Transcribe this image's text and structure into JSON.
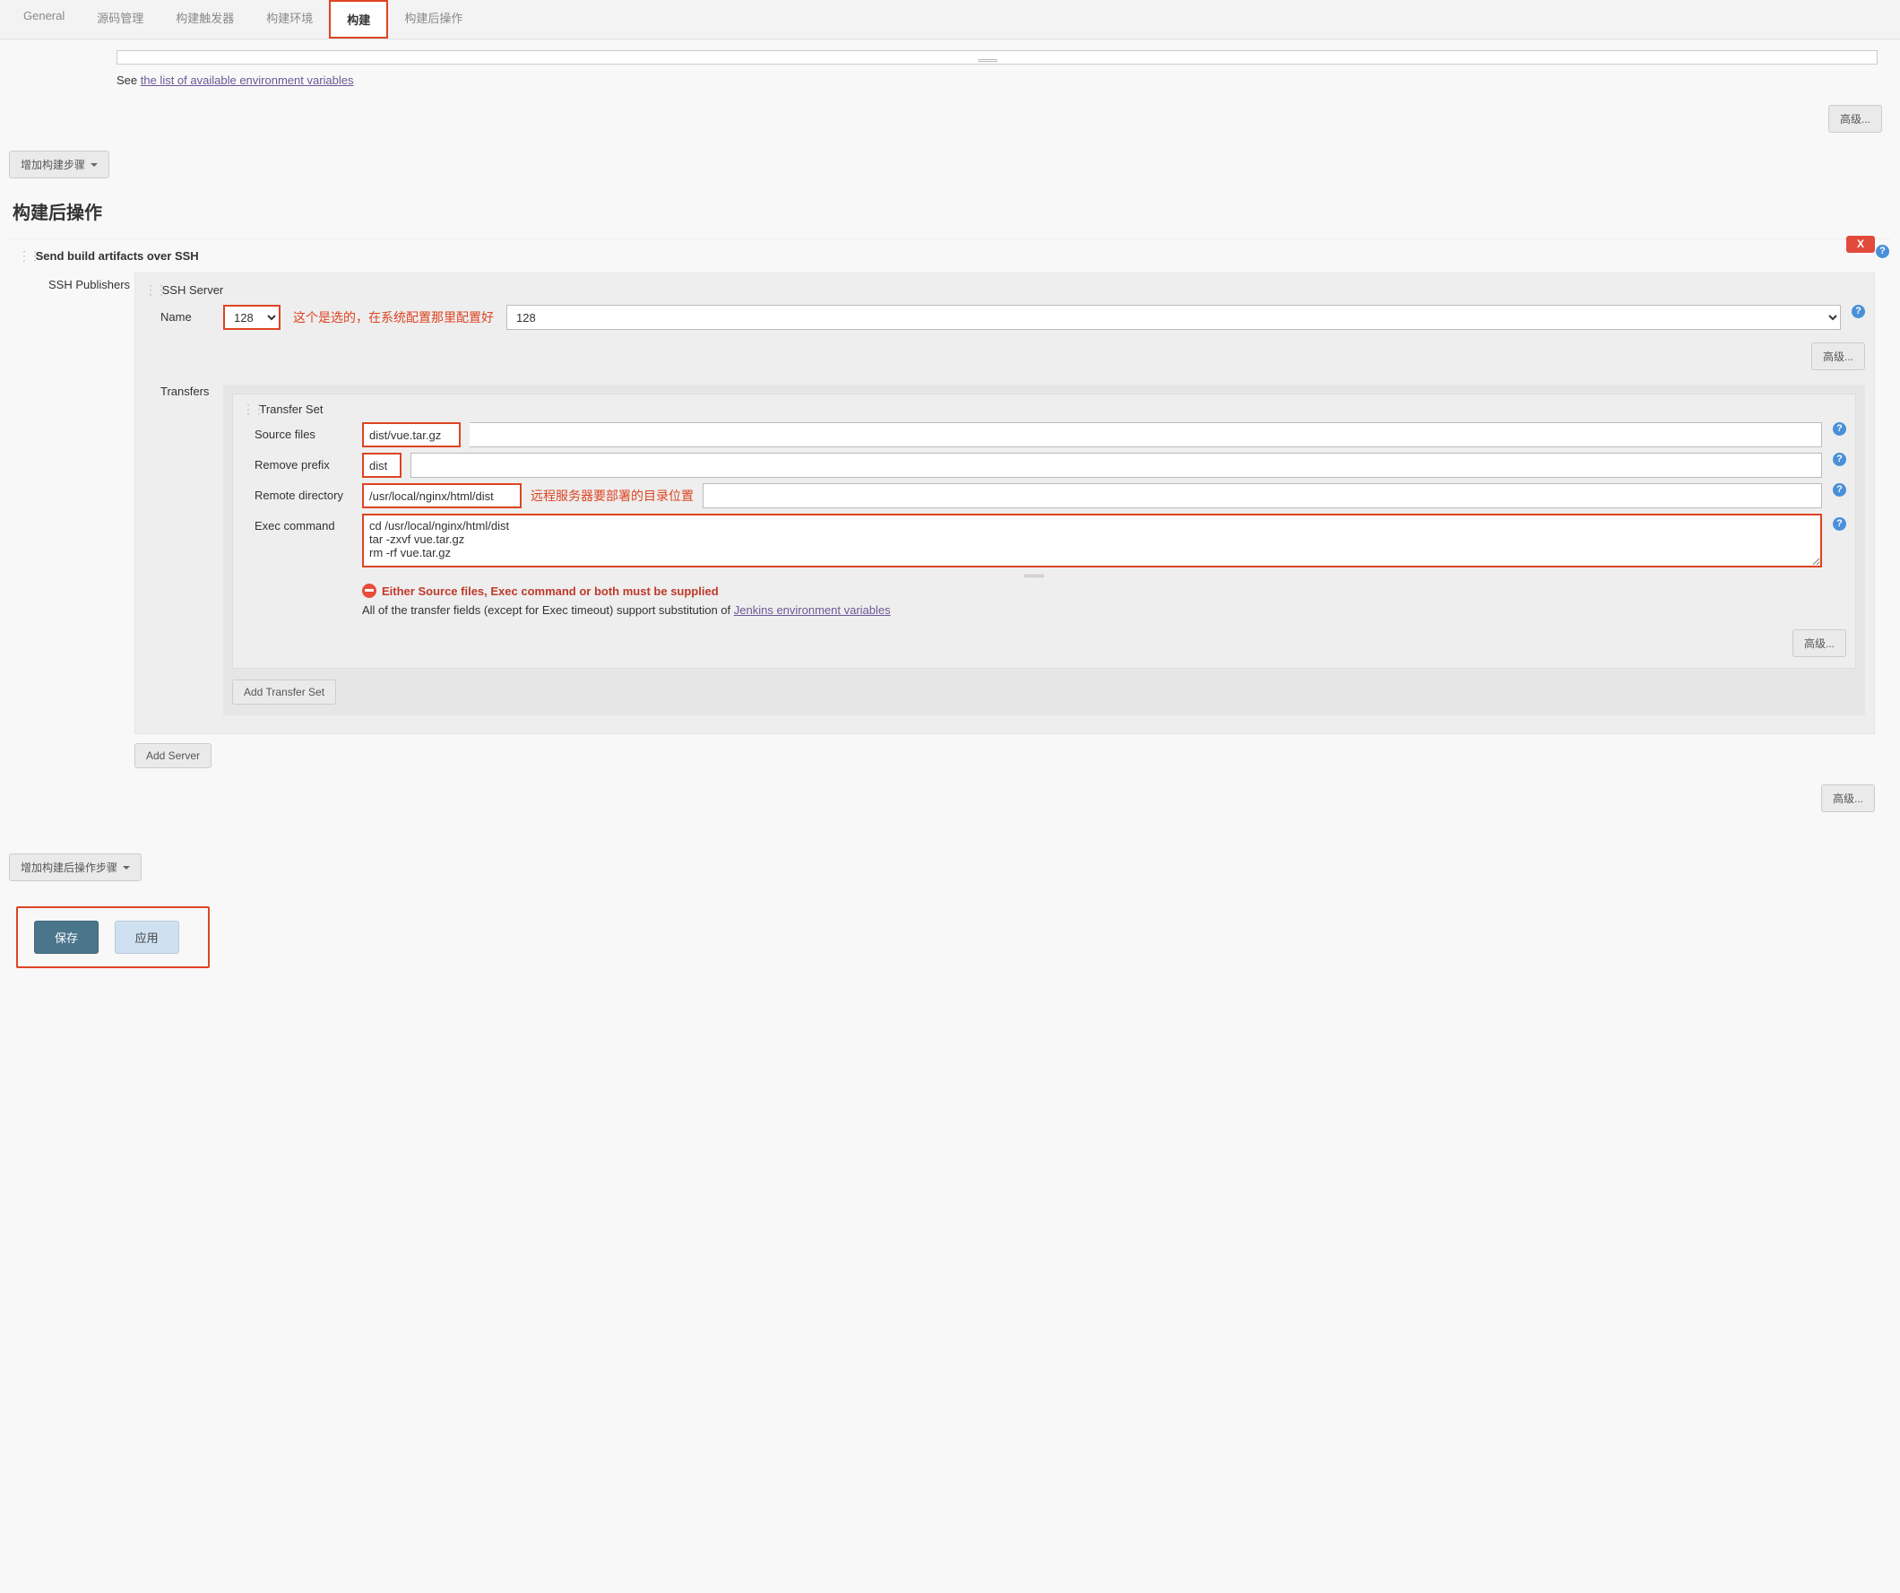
{
  "tabs": {
    "general": "General",
    "scm": "源码管理",
    "triggers": "构建触发器",
    "env": "构建环境",
    "build": "构建",
    "post": "构建后操作"
  },
  "upper": {
    "see": "See ",
    "env_link": "the list of available environment variables",
    "advanced": "高级...",
    "add_step": "增加构建步骤"
  },
  "post_title": "构建后操作",
  "block": {
    "title": "Send build artifacts over SSH",
    "close": "X",
    "ssh_publishers_label": "SSH Publishers",
    "ssh_server_label": "SSH Server",
    "name_label": "Name",
    "name_value": "128",
    "name_annot": "这个是选的，在系统配置那里配置好",
    "advanced": "高级...",
    "transfers_label": "Transfers",
    "transfer_set_label": "Transfer Set",
    "source_label": "Source files",
    "source_value": "dist/vue.tar.gz",
    "prefix_label": "Remove prefix",
    "prefix_value": "dist",
    "remote_label": "Remote directory",
    "remote_value": "/usr/local/nginx/html/dist",
    "remote_annot": "远程服务器要部署的目录位置",
    "exec_label": "Exec command",
    "exec_value": "cd /usr/local/nginx/html/dist\ntar -zxvf vue.tar.gz\nrm -rf vue.tar.gz",
    "error": "Either Source files, Exec command or both must be supplied",
    "note_pre": "All of the transfer fields (except for Exec timeout) support substitution of ",
    "note_link": "Jenkins environment variables",
    "add_transfer_set": "Add Transfer Set",
    "add_server": "Add Server"
  },
  "bottom": {
    "advanced": "高级...",
    "add_post_step": "增加构建后操作步骤",
    "save": "保存",
    "apply": "应用"
  }
}
